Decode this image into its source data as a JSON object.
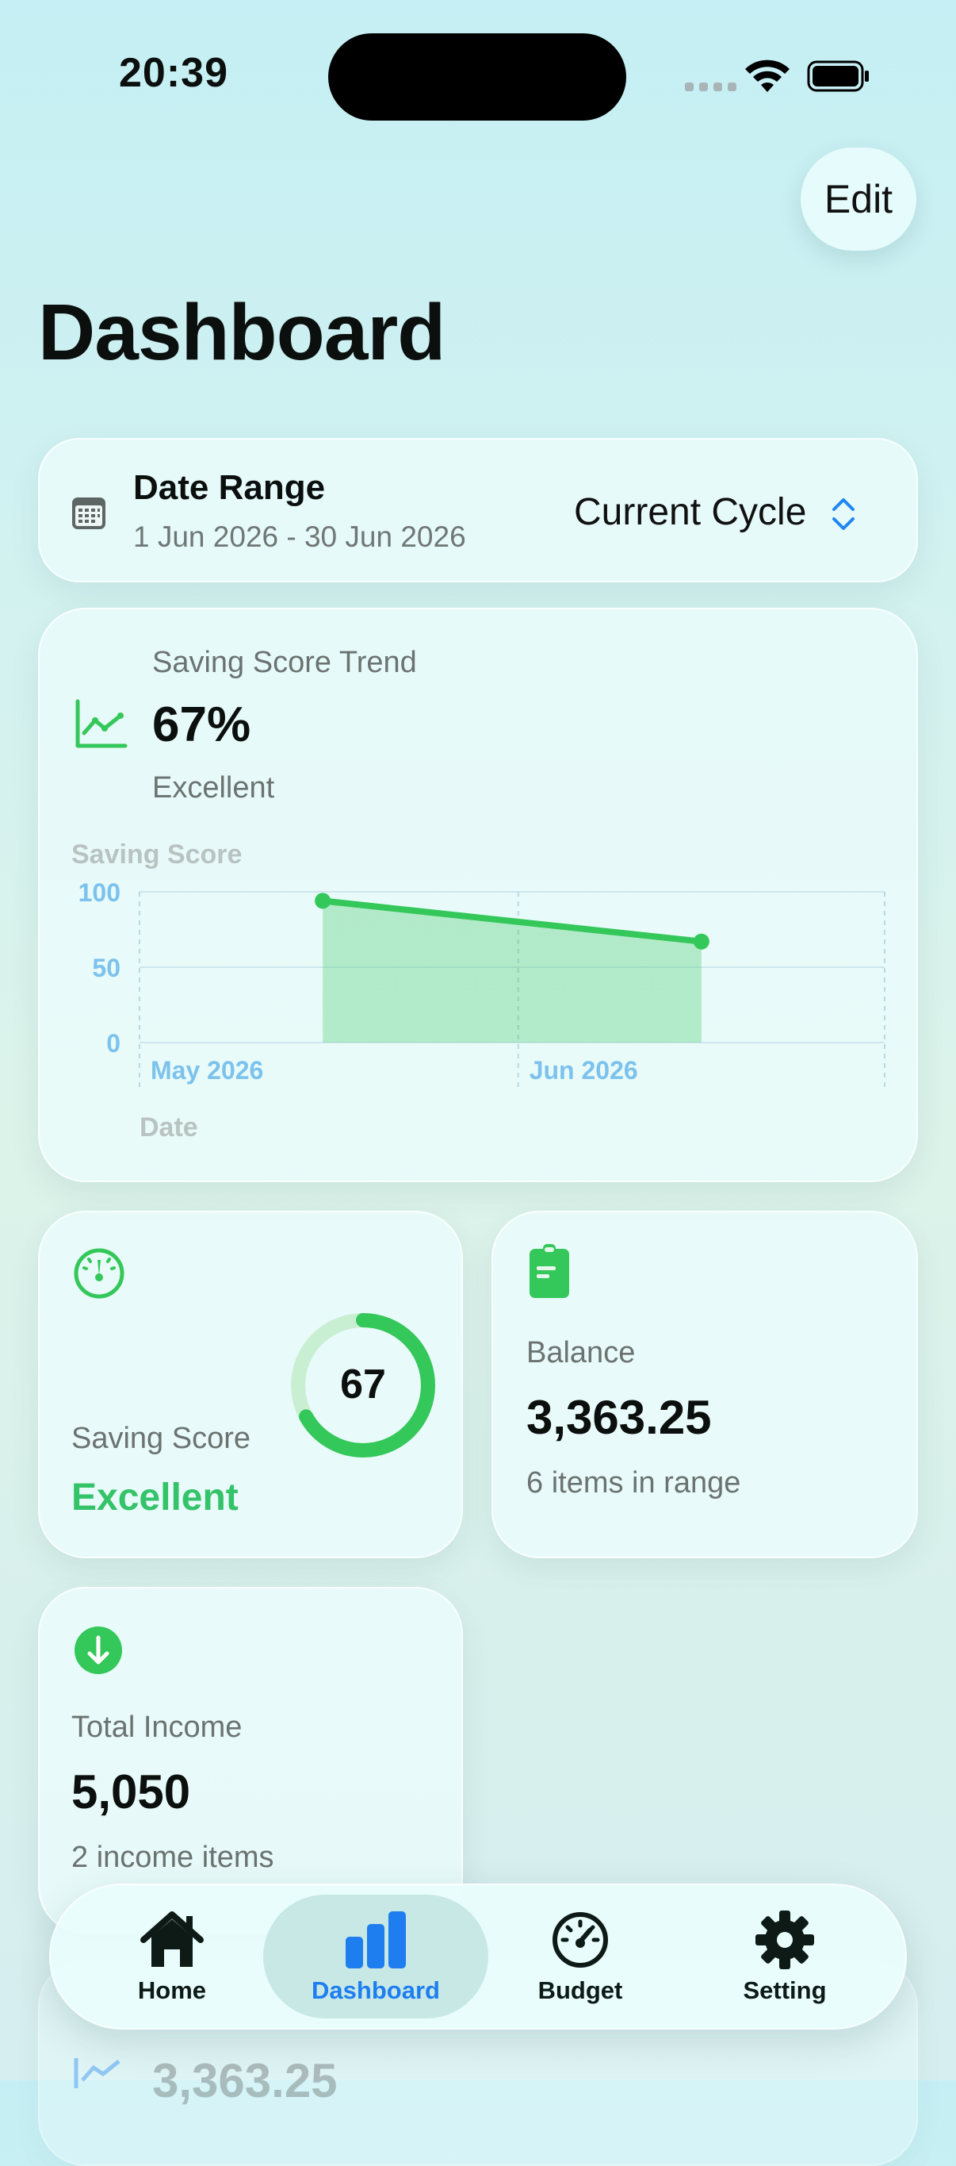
{
  "status_bar": {
    "time": "20:39"
  },
  "header": {
    "edit_label": "Edit",
    "title": "Dashboard"
  },
  "date_range": {
    "title": "Date Range",
    "range_text": "1 Jun 2026 - 30 Jun 2026",
    "selector_value": "Current Cycle"
  },
  "trend": {
    "label": "Saving Score Trend",
    "value": "67%",
    "status": "Excellent"
  },
  "chart_data": {
    "type": "area",
    "title": "",
    "ylabel": "Saving Score",
    "xlabel": "Date",
    "x_tick_labels": [
      "May 2026",
      "Jun 2026"
    ],
    "y_ticks": [
      0,
      50,
      100
    ],
    "ylim": [
      0,
      100
    ],
    "series": [
      {
        "points": [
          {
            "x": "2026-05-16",
            "y": 94
          },
          {
            "x": "2026-06-16",
            "y": 67
          }
        ]
      }
    ],
    "color": "#34c759"
  },
  "score_card": {
    "value": "67",
    "label": "Saving Score",
    "status": "Excellent",
    "progress": 0.67
  },
  "balance_card": {
    "label": "Balance",
    "value": "3,363.25",
    "sub": "6 items in range"
  },
  "income_card": {
    "label": "Total Income",
    "value": "5,050",
    "sub": "2 income items"
  },
  "peek_card": {
    "value": "3,363.25"
  },
  "tabbar": {
    "home": "Home",
    "dashboard": "Dashboard",
    "budget": "Budget",
    "setting": "Setting",
    "selected": "Dashboard"
  },
  "colors": {
    "accent": "#007aff",
    "green": "#34c759",
    "text": "#0b0f0d",
    "secondary": "#6b7371"
  },
  "icons": [
    "calendar-icon",
    "chevron-updown-icon",
    "trend-chart-icon",
    "gauge-icon",
    "wallet-icon",
    "arrow-down-circle-icon",
    "house-icon",
    "bar-chart-icon",
    "speedometer-icon",
    "gear-icon"
  ]
}
